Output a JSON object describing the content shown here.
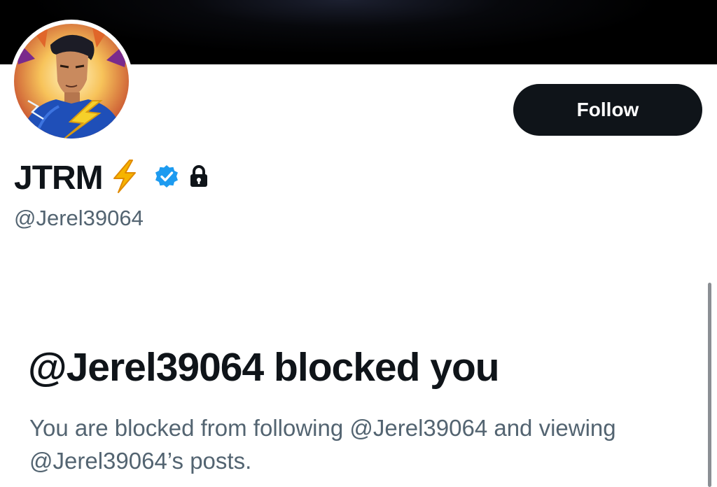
{
  "profile": {
    "display_name": "JTRM",
    "handle": "@Jerel39064",
    "name_emoji": "lightning-bolt-emoji",
    "badges": [
      "verified-badge-icon",
      "lock-icon"
    ]
  },
  "actions": {
    "follow_label": "Follow"
  },
  "blocked": {
    "title": "@Jerel39064 blocked you",
    "description": "You are blocked from following @Jerel39064 and viewing @Jerel39064’s posts."
  },
  "colors": {
    "primary_text": "#0f1419",
    "secondary_text": "#536471",
    "verified_blue": "#1d9bf0",
    "button_bg": "#0f1419",
    "button_text": "#ffffff",
    "bolt_yellow": "#f6b400"
  }
}
